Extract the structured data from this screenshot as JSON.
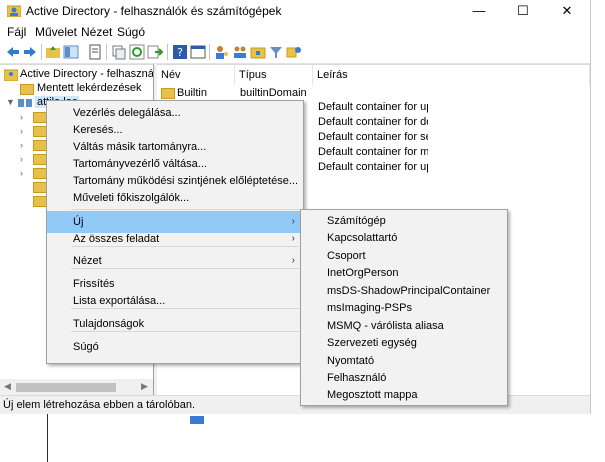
{
  "window": {
    "title": "Active Directory - felhasználók és számítógépek",
    "controls": {
      "minimize": "—",
      "maximize": "☐",
      "close": "✕"
    }
  },
  "menubar": [
    "Fájl",
    "Művelet",
    "Nézet",
    "Súgó"
  ],
  "toolbar_icons": [
    "back-icon",
    "forward-icon",
    "up-folder-icon",
    "show-tree-icon",
    "properties-icon",
    "copy-icon",
    "refresh-icon",
    "export-icon",
    "help-icon",
    "console-icon",
    "users-icon",
    "group-icon",
    "ou-icon",
    "filter-icon",
    "delegate-icon"
  ],
  "tree": {
    "root": "Active Directory - felhasználók é",
    "saved_queries": "Mentett lekérdezések",
    "domain": "attila.loc"
  },
  "list": {
    "columns": [
      "Név",
      "Típus",
      "Leírás"
    ],
    "rows": [
      {
        "name": "Builtin",
        "type": "builtinDomain",
        "desc": ""
      },
      {
        "name": "",
        "type": "",
        "desc": "Default container for up..."
      },
      {
        "name": "",
        "type": "",
        "desc": "Default container for do..."
      },
      {
        "name": "",
        "type": "",
        "desc": "Default container for sec..."
      },
      {
        "name": "",
        "type": "",
        "desc": "Default container for ma..."
      },
      {
        "name": "",
        "type": "",
        "desc": "Default container for up..."
      }
    ]
  },
  "context_menu": {
    "items": [
      "Vezérlés delegálása...",
      "Keresés...",
      "Váltás másik tartományra...",
      "Tartományvezérlő váltása...",
      "Tartomány működési szintjének előléptetése...",
      "Műveleti főkiszolgálók...",
      "Új",
      "Az összes feladat",
      "Nézet",
      "Frissítés",
      "Lista exportálása...",
      "Tulajdonságok",
      "Súgó"
    ],
    "submenu_arrow": "›"
  },
  "submenu_new": [
    "Számítógép",
    "Kapcsolattartó",
    "Csoport",
    "InetOrgPerson",
    "msDS-ShadowPrincipalContainer",
    "msImaging-PSPs",
    "MSMQ - várólista aliasa",
    "Szervezeti egység",
    "Nyomtató",
    "Felhasználó",
    "Megosztott mappa"
  ],
  "status": "Új elem létrehozása ebben a tárolóban.",
  "colors": {
    "highlight": "#91c9f7",
    "menu_bg": "#f2f2f2",
    "folder": "#e8c14a"
  }
}
